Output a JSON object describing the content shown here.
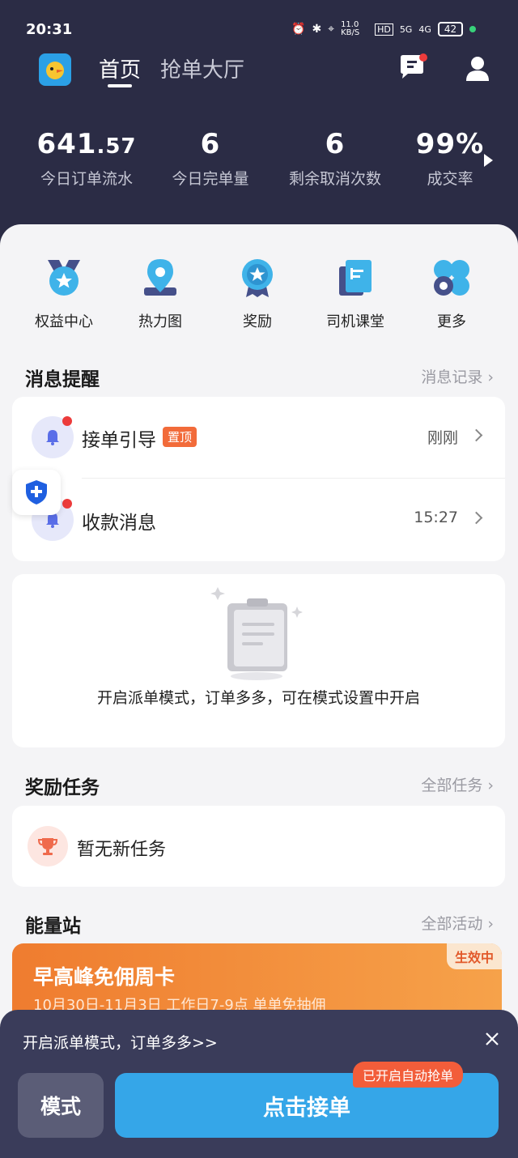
{
  "status_bar": {
    "time": "20:31",
    "net_speed": "11.0 KB/S",
    "hd": "HD",
    "signal1": "5G",
    "signal2": "4G",
    "battery": "42"
  },
  "header": {
    "tab_home": "首页",
    "tab_hall": "抢单大厅",
    "icons": [
      "app-logo-icon",
      "message-icon",
      "user-icon"
    ]
  },
  "stats": [
    {
      "value_main": "641",
      "value_decimal": ".57",
      "label": "今日订单流水"
    },
    {
      "value_main": "6",
      "value_decimal": "",
      "label": "今日完单量"
    },
    {
      "value_main": "6",
      "value_decimal": "",
      "label": "剩余取消次数"
    },
    {
      "value_main": "99%",
      "value_decimal": "",
      "label": "成交率"
    }
  ],
  "quick_actions": [
    {
      "label": "权益中心",
      "icon": "badge-star-icon"
    },
    {
      "label": "热力图",
      "icon": "map-pin-icon"
    },
    {
      "label": "奖励",
      "icon": "medal-icon"
    },
    {
      "label": "司机课堂",
      "icon": "book-icon"
    },
    {
      "label": "更多",
      "icon": "more-grid-icon"
    }
  ],
  "messages": {
    "title": "消息提醒",
    "link": "消息记录",
    "items": [
      {
        "title": "接单引导",
        "badge": "置顶",
        "time": "刚刚"
      },
      {
        "title": "收款消息",
        "badge": "",
        "time": "15:27"
      }
    ]
  },
  "dispatch_hint": {
    "text": "开启派单模式，订单多多，可在模式设置中开启"
  },
  "tasks": {
    "title": "奖励任务",
    "link": "全部任务",
    "empty": "暂无新任务"
  },
  "energy": {
    "title": "能量站",
    "link": "全部活动",
    "promo_title": "早高峰免佣周卡",
    "promo_sub": "10月30日-11月3日 工作日7-9点 单单免抽佣",
    "promo_badge": "生效中"
  },
  "bottom": {
    "tip": "开启派单模式，订单多多>>",
    "mode_button": "模式",
    "accept_button": "点击接单",
    "auto_badge": "已开启自动抢单"
  },
  "colors": {
    "header_bg": "#2b2c45",
    "accent_blue": "#35a6e8",
    "badge_orange": "#f26b3a",
    "unread_red": "#ec3b3b"
  }
}
